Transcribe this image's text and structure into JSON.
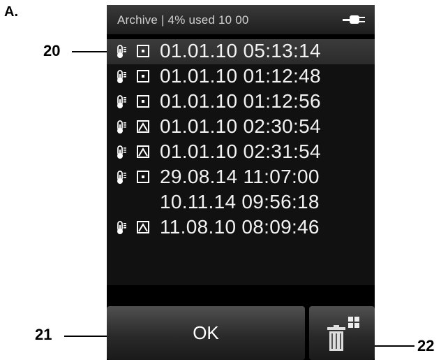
{
  "figure": {
    "label": "A.",
    "callouts": [
      "20",
      "21",
      "22"
    ]
  },
  "screen": {
    "status": "Archive | 4% used  10 00",
    "icons": {
      "power": "plug-icon",
      "temperature": "thermometer-icon",
      "delete": "trash-icon"
    },
    "entries": [
      {
        "time": "01.01.10 05:13:14",
        "mode": "spot",
        "thermometer": true,
        "selected": true
      },
      {
        "time": "01.01.10 01:12:48",
        "mode": "spot",
        "thermometer": true,
        "selected": false
      },
      {
        "time": "01.01.10 01:12:56",
        "mode": "spot",
        "thermometer": true,
        "selected": false
      },
      {
        "time": "01.01.10 02:30:54",
        "mode": "area",
        "thermometer": true,
        "selected": false
      },
      {
        "time": "01.01.10 02:31:54",
        "mode": "area",
        "thermometer": true,
        "selected": false
      },
      {
        "time": "29.08.14 11:07:00",
        "mode": "spot",
        "thermometer": true,
        "selected": false
      },
      {
        "time": "10.11.14 09:56:18",
        "mode": "none",
        "thermometer": false,
        "selected": false
      },
      {
        "time": "11.08.10 08:09:46",
        "mode": "area",
        "thermometer": true,
        "selected": false
      }
    ],
    "ok_label": "OK"
  }
}
